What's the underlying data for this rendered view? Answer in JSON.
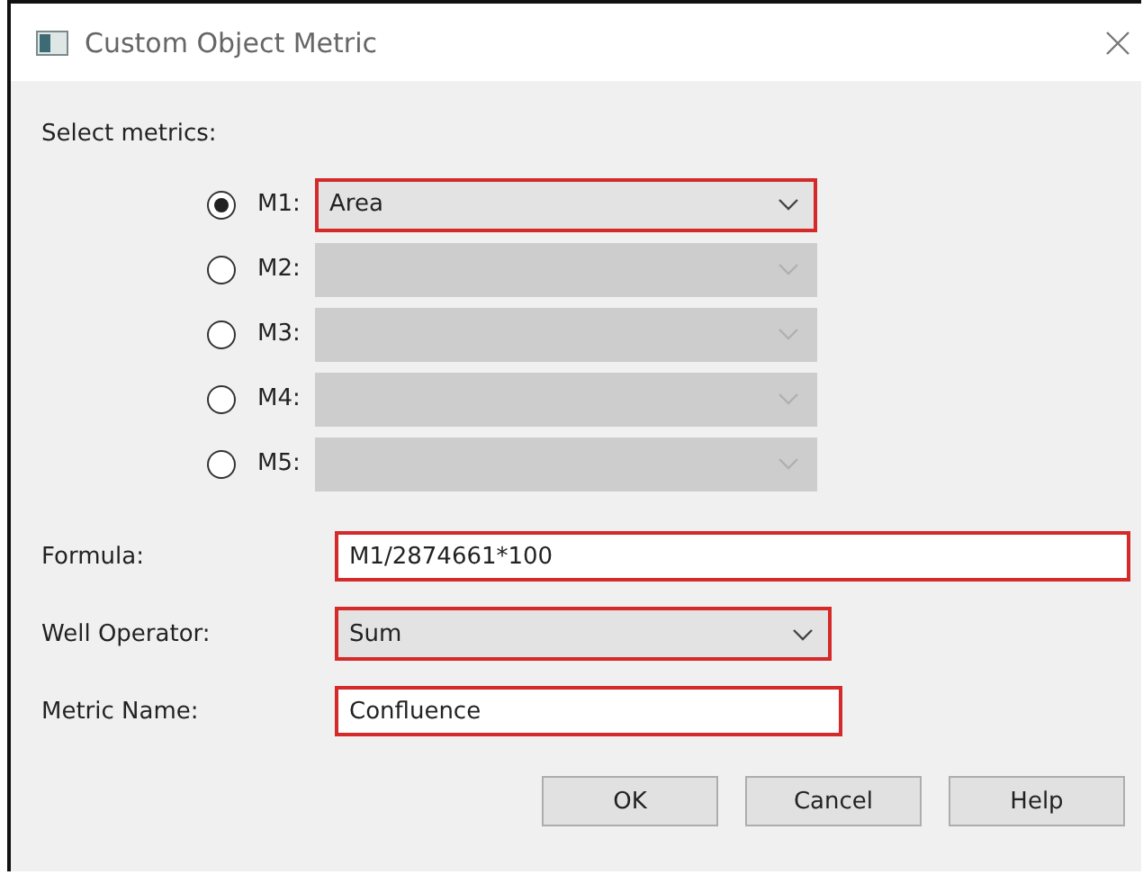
{
  "window": {
    "title": "Custom Object Metric"
  },
  "select_label": "Select metrics:",
  "metrics": [
    {
      "label": "M1:",
      "selected": true,
      "disabled": false,
      "value": "Area",
      "highlighted": true
    },
    {
      "label": "M2:",
      "selected": false,
      "disabled": true,
      "highlighted": false
    },
    {
      "label": "M3:",
      "selected": false,
      "disabled": true,
      "highlighted": false
    },
    {
      "label": "M4:",
      "selected": false,
      "disabled": true,
      "highlighted": false
    },
    {
      "label": "M5:",
      "selected": false,
      "disabled": true,
      "highlighted": false
    }
  ],
  "fields": [
    {
      "kind": "text",
      "label": "Formula:",
      "value": "M1/2874661*100",
      "highlighted": true
    },
    {
      "kind": "combo",
      "label": "Well Operator:",
      "value": "Sum",
      "highlighted": true
    },
    {
      "kind": "text",
      "label": "Metric Name:",
      "value": "Confluence",
      "highlighted": true
    }
  ],
  "buttons": [
    "OK",
    "Cancel",
    "Help"
  ]
}
